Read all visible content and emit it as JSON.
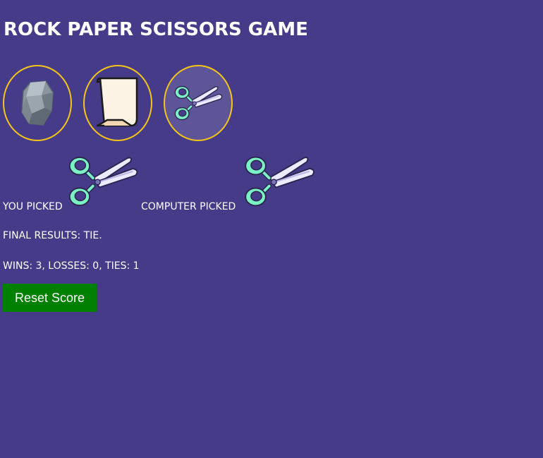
{
  "header": {
    "title": "ROCK PAPER SCISSORS GAME"
  },
  "choices": [
    {
      "name": "rock",
      "icon": "rock-icon",
      "selected": false
    },
    {
      "name": "paper",
      "icon": "paper-icon",
      "selected": false
    },
    {
      "name": "scissors",
      "icon": "scissors-icon",
      "selected": true
    }
  ],
  "picks": {
    "you_label": "YOU PICKED",
    "you_icon": "scissors-icon",
    "computer_label": "COMPUTER PICKED",
    "computer_icon": "scissors-icon"
  },
  "result": {
    "text": "FINAL RESULTS: TIE."
  },
  "score": {
    "text": "WINS: 3, LOSSES: 0, TIES: 1"
  },
  "controls": {
    "reset_label": "Reset Score"
  },
  "colors": {
    "background": "#463b89",
    "ring": "#f5c518",
    "selected_fill": "#5e5498",
    "reset_button": "#008000"
  }
}
